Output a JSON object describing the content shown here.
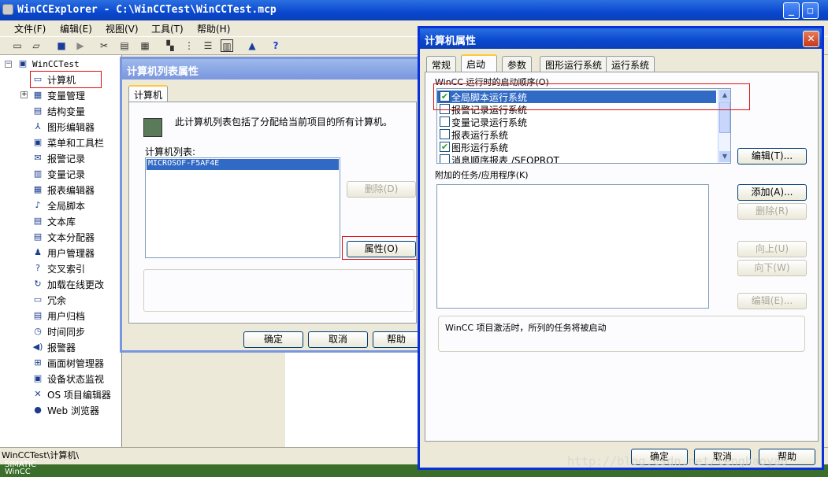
{
  "window": {
    "title": "WinCCExplorer - C:\\WinCCTest\\WinCCTest.mcp",
    "minimize": "_",
    "maximize": "□"
  },
  "menu": [
    "文件(F)",
    "编辑(E)",
    "视图(V)",
    "工具(T)",
    "帮助(H)"
  ],
  "toolbar": [
    "new-icon",
    "open-icon",
    "stop-icon",
    "play-icon",
    "cut-icon",
    "copy-icon",
    "paste-icon",
    "list-icon",
    "tree-icon",
    "details-icon",
    "grid-icon",
    "properties-icon",
    "help-icon"
  ],
  "tree": {
    "root": "WinCCTest",
    "items": [
      "计算机",
      "变量管理",
      "结构变量",
      "图形编辑器",
      "菜单和工具栏",
      "报警记录",
      "变量记录",
      "报表编辑器",
      "全局脚本",
      "文本库",
      "文本分配器",
      "用户管理器",
      "交叉索引",
      "加载在线更改",
      "冗余",
      "用户归档",
      "时间同步",
      "报警器",
      "画面树管理器",
      "设备状态监视",
      "OS 项目编辑器",
      "Web 浏览器"
    ]
  },
  "status": "WinCCTest\\计算机\\",
  "desktop": {
    "line1": "SIMATIC",
    "line2": "WinCC"
  },
  "list_dialog": {
    "title": "计算机列表属性",
    "tab": "计算机",
    "info": "此计算机列表包括了分配给当前项目的所有计算机。",
    "list_label": "计算机列表:",
    "computers": [
      "MICROSOF-F5AF4E"
    ],
    "delete": "删除(D)",
    "properties": "属性(O)",
    "ok": "确定",
    "cancel": "取消",
    "help": "帮助"
  },
  "props_dialog": {
    "title": "计算机属性",
    "tabs": [
      "常规",
      "启动",
      "参数",
      "图形运行系统",
      "运行系统"
    ],
    "startup_label": "WinCC 运行时的启动顺序(O)",
    "startup_items": [
      {
        "label": "全局脚本运行系统",
        "checked": true
      },
      {
        "label": "报警记录运行系统",
        "checked": false
      },
      {
        "label": "变量记录运行系统",
        "checked": false
      },
      {
        "label": "报表运行系统",
        "checked": false
      },
      {
        "label": "图形运行系统",
        "checked": true
      },
      {
        "label": "消息顺序报表 /SEQPROT",
        "checked": false
      }
    ],
    "edit": "编辑(T)...",
    "additional_label": "附加的任务/应用程序(K)",
    "add": "添加(A)...",
    "delete": "删除(R)",
    "up": "向上(U)",
    "down": "向下(W)",
    "edit2": "编辑(E)...",
    "note": "WinCC 项目激活时，所列的任务将被启动",
    "ok": "确定",
    "cancel": "取消",
    "help": "帮助",
    "close": "✕"
  },
  "watermark": "http://blog.csdn.net/tenghaoyao"
}
